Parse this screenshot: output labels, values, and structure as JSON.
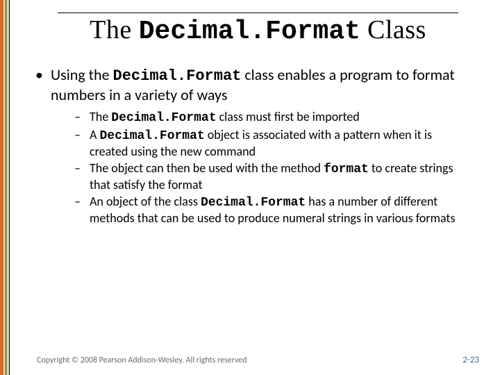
{
  "title": {
    "pre": "The ",
    "code": "Decimal.Format",
    "post": " Class"
  },
  "bullets": {
    "main": {
      "seg1": "Using the ",
      "code1": "Decimal.Format",
      "seg2": " class enables a program to format numbers in a variety of ways"
    },
    "sub": [
      {
        "seg1": "The ",
        "code1": "Decimal.Format",
        "seg2": " class must first be imported"
      },
      {
        "seg1": "A ",
        "code1": "Decimal.Format",
        "seg2": " object is associated with a pattern when it is created using the new command"
      },
      {
        "seg1": "The object can then be used with the method ",
        "code1": "format",
        "seg2": " to create strings that satisfy the format"
      },
      {
        "seg1": "An object of the class ",
        "code1": "Decimal.Format",
        "seg2": " has a number of different methods that can be used to produce numeral strings in various formats"
      }
    ]
  },
  "footer": {
    "copyright": "Copyright © 2008 Pearson Addison-Wesley. All rights reserved",
    "page": "2-23"
  }
}
